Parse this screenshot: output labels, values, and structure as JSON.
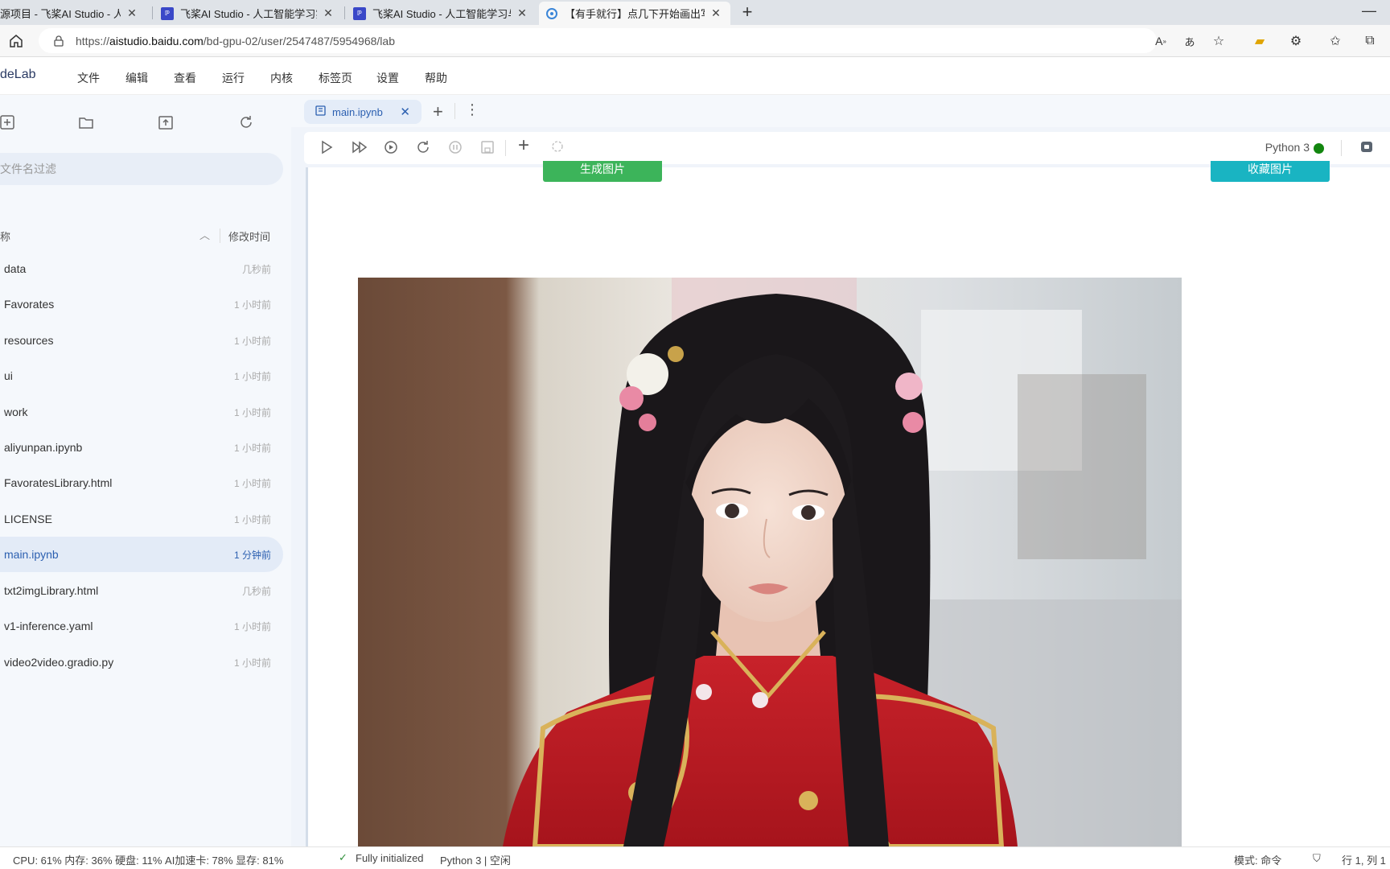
{
  "browser": {
    "tabs": [
      {
        "title": "源项目 - 飞桨AI Studio - 人工智",
        "active": false
      },
      {
        "title": "飞桨AI Studio - 人工智能学习实训",
        "active": false
      },
      {
        "title": "飞桨AI Studio - 人工智能学习与实",
        "active": false
      },
      {
        "title": "【有手就行】点几下开始画出写真",
        "active": true
      }
    ],
    "url_prefix": "https://",
    "url_host": "aistudio.baidu.com",
    "url_path": "/bd-gpu-02/user/2547487/5954968/lab"
  },
  "menubar": {
    "logo": "deLab",
    "items": [
      "文件",
      "编辑",
      "查看",
      "运行",
      "内核",
      "标签页",
      "设置",
      "帮助"
    ]
  },
  "sidebar": {
    "filter_placeholder": "按文件名过滤",
    "col_name": "称",
    "col_modified": "修改时间",
    "files": [
      {
        "name": "data",
        "time": "几秒前",
        "selected": false
      },
      {
        "name": "Favorates",
        "time": "1 小时前",
        "selected": false
      },
      {
        "name": "resources",
        "time": "1 小时前",
        "selected": false
      },
      {
        "name": "ui",
        "time": "1 小时前",
        "selected": false
      },
      {
        "name": "work",
        "time": "1 小时前",
        "selected": false
      },
      {
        "name": "aliyunpan.ipynb",
        "time": "1 小时前",
        "selected": false
      },
      {
        "name": "FavoratesLibrary.html",
        "time": "1 小时前",
        "selected": false
      },
      {
        "name": "LICENSE",
        "time": "1 小时前",
        "selected": false
      },
      {
        "name": "main.ipynb",
        "time": "1 分钟前",
        "selected": true
      },
      {
        "name": "txt2imgLibrary.html",
        "time": "几秒前",
        "selected": false
      },
      {
        "name": "v1-inference.yaml",
        "time": "1 小时前",
        "selected": false
      },
      {
        "name": "video2video.gradio.py",
        "time": "1 小时前",
        "selected": false
      }
    ]
  },
  "notebook": {
    "tab_label": "main.ipynb",
    "kernel_name": "Python 3",
    "generate_button": "生成图片",
    "favorite_button": "收藏图片",
    "image_subject": "portrait of young woman with long black hair, flowers in hair, red embroidered qipao"
  },
  "statusbar": {
    "resources": "CPU:  61% 内存:  36% 硬盘:  11% AI加速卡:  78% 显存:  81%",
    "init": "Fully initialized",
    "kernel_state": "Python 3 | 空闲",
    "mode": "模式: 命令",
    "position": "行 1,  列 1"
  },
  "colors": {
    "kernel_idle": "#12860f",
    "generate": "#3cb45a",
    "favorite": "#19b4c2",
    "accent": "#2b5fb0"
  }
}
